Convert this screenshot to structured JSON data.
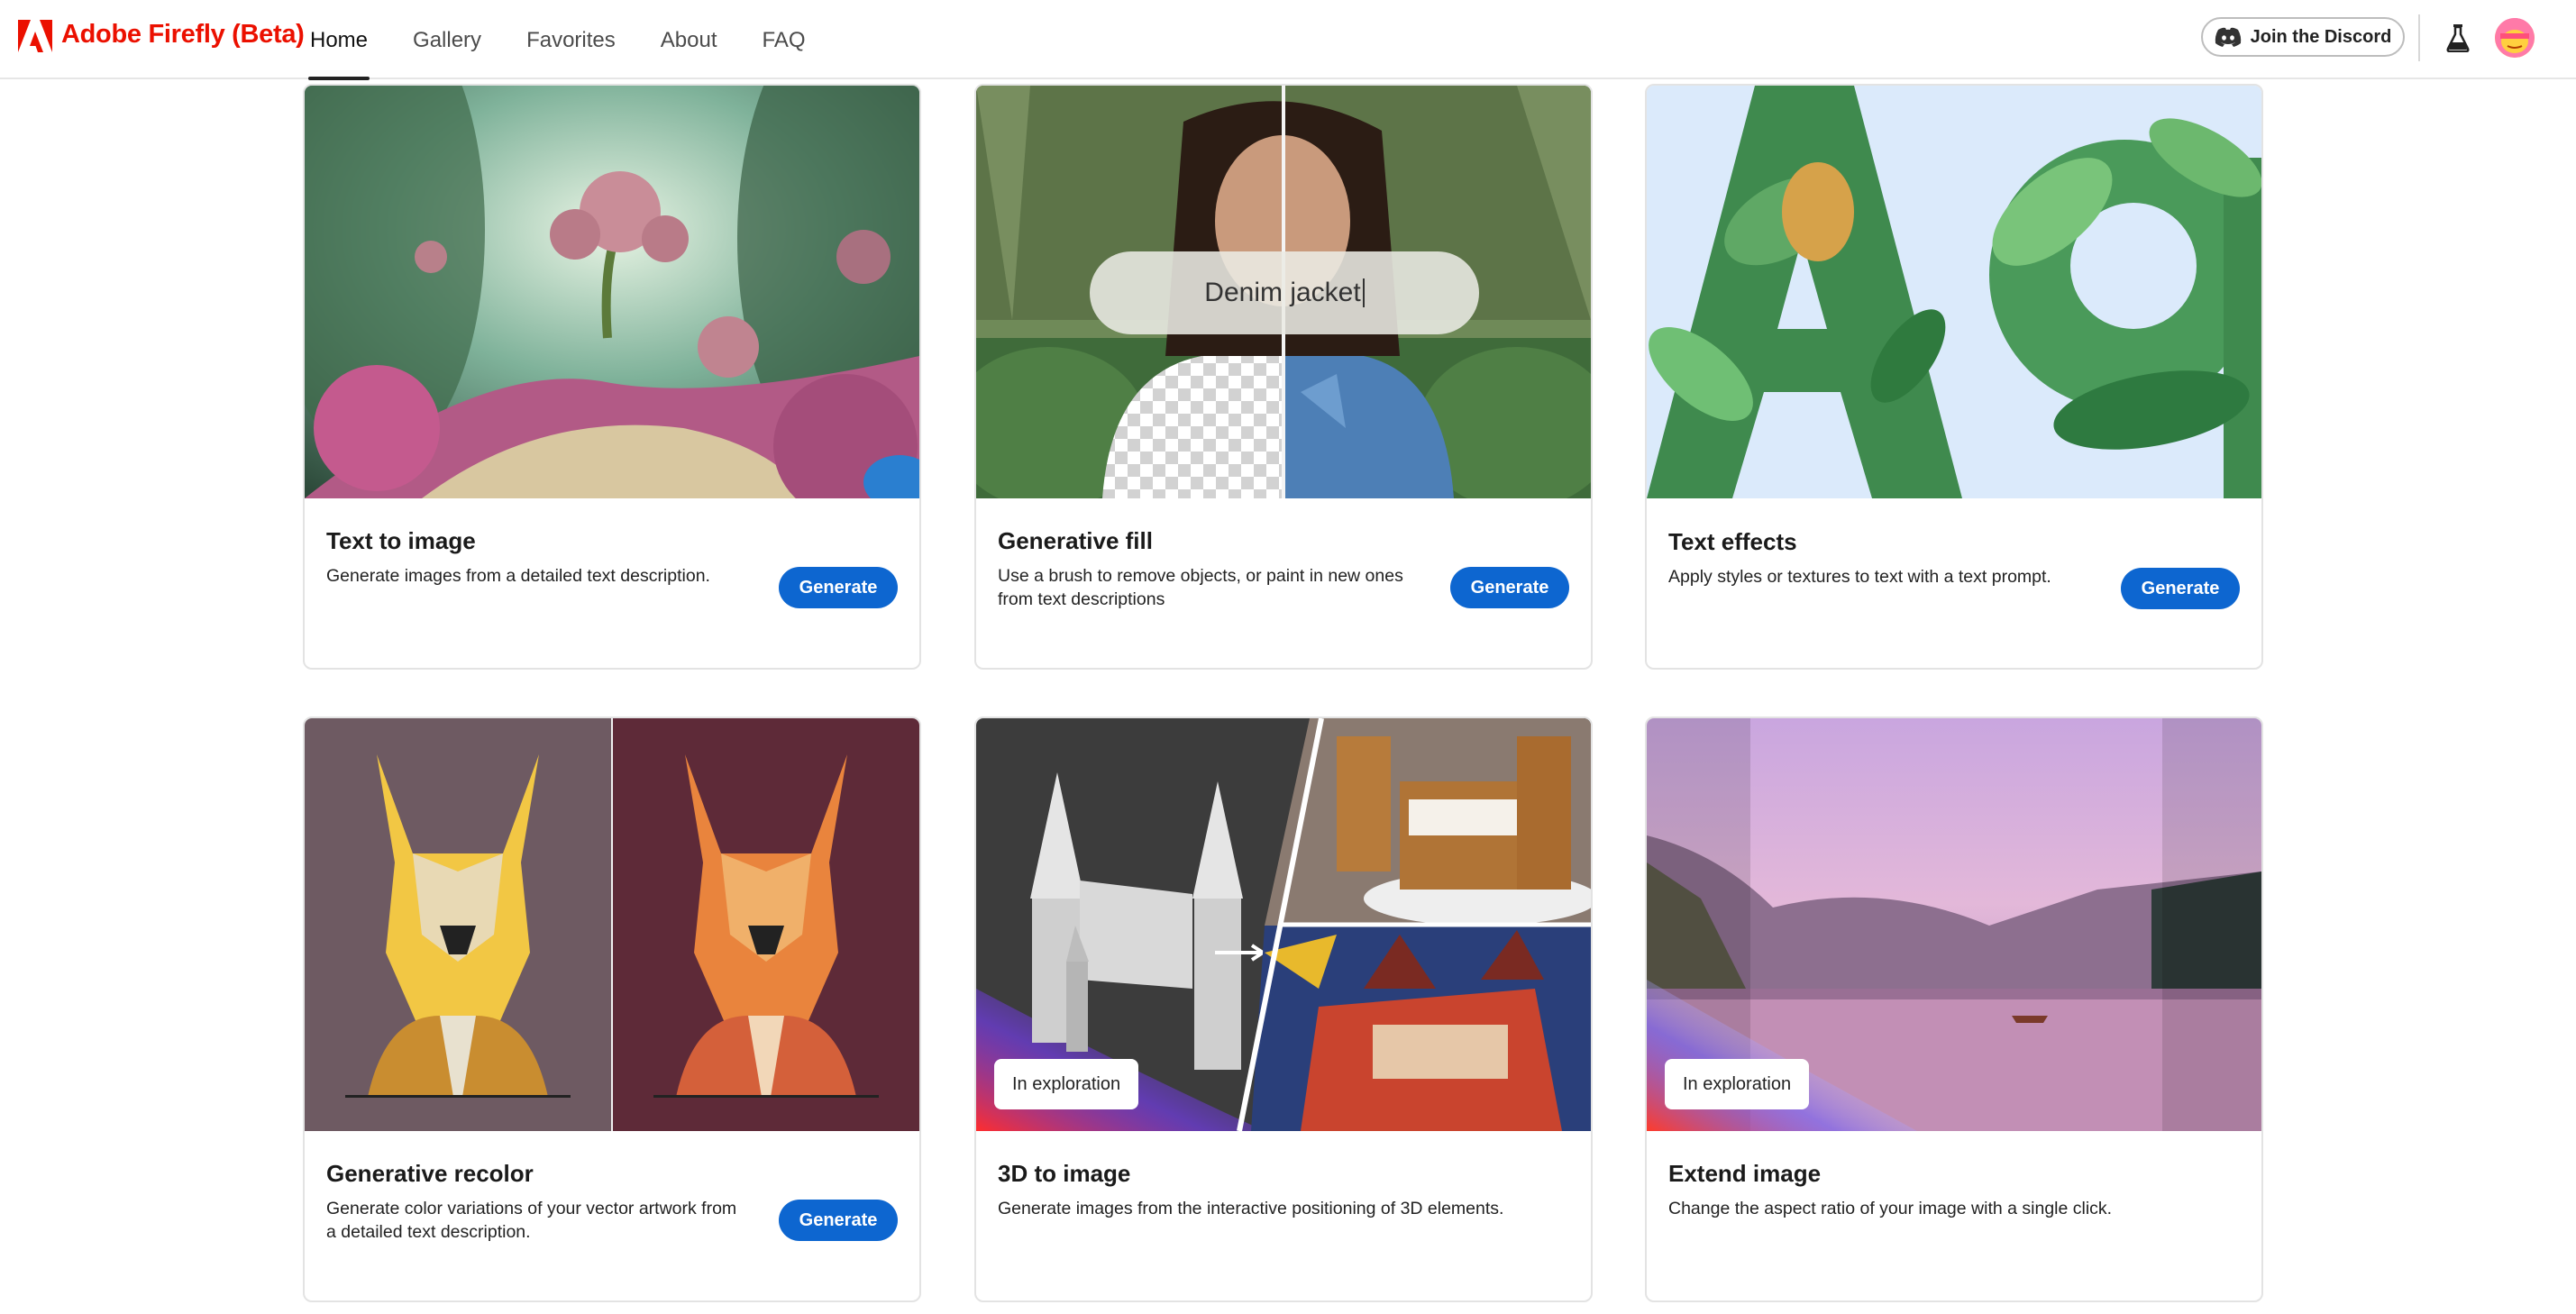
{
  "app": {
    "brand": "Adobe Firefly (Beta)",
    "brand_color": "#eb1000",
    "accent_color": "#0d66d0"
  },
  "nav": {
    "items": [
      {
        "label": "Home",
        "active": true
      },
      {
        "label": "Gallery",
        "active": false
      },
      {
        "label": "Favorites",
        "active": false
      },
      {
        "label": "About",
        "active": false
      },
      {
        "label": "FAQ",
        "active": false
      }
    ]
  },
  "header_actions": {
    "discord_label": "Join the Discord",
    "discord_icon": "discord-icon",
    "labs_icon": "flask-icon",
    "avatar_icon": "avatar"
  },
  "cards": [
    {
      "title": "Text to image",
      "description": "Generate images from a detailed text description.",
      "button": "Generate",
      "image": "fantasy-garden"
    },
    {
      "title": "Generative fill",
      "description": "Use a brush to remove objects, or paint in new ones from text descriptions",
      "button": "Generate",
      "image": "woman-denim",
      "overlay_prompt": "Denim jacket"
    },
    {
      "title": "Text effects",
      "description": "Apply styles or textures to text with a text prompt.",
      "button": "Generate",
      "image": "leafy-letters"
    },
    {
      "title": "Generative recolor",
      "description": "Generate color variations of your vector artwork from a detailed text description.",
      "button": "Generate",
      "image": "recolored-dogs"
    },
    {
      "title": "3D to image",
      "description": "Generate images from the interactive positioning of 3D elements.",
      "badge": "In exploration",
      "image": "castle-3d"
    },
    {
      "title": "Extend image",
      "description": "Change the aspect ratio of your image with a single click.",
      "badge": "In exploration",
      "image": "lake-sunset"
    }
  ]
}
